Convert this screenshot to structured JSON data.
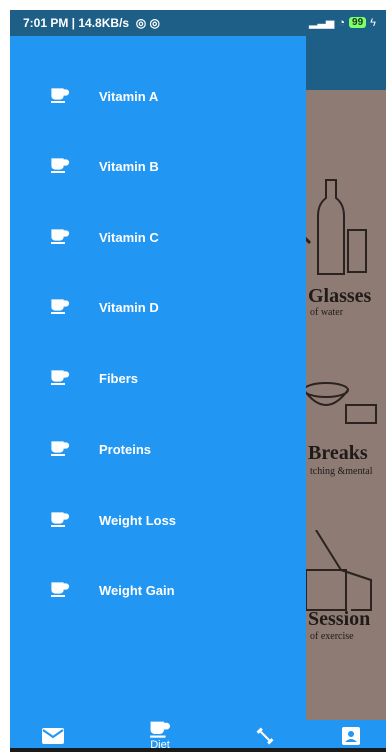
{
  "status_bar": {
    "time": "7:01 PM | 14.8KB/s",
    "battery": "99"
  },
  "drawer": {
    "items": [
      {
        "label": "Vitamin A",
        "icon": "coffee-cup-icon"
      },
      {
        "label": "Vitamin B",
        "icon": "coffee-cup-icon"
      },
      {
        "label": "Vitamin C",
        "icon": "coffee-cup-icon"
      },
      {
        "label": "Vitamin D",
        "icon": "coffee-cup-icon"
      },
      {
        "label": "Fibers",
        "icon": "coffee-cup-icon"
      },
      {
        "label": "Proteins",
        "icon": "coffee-cup-icon"
      },
      {
        "label": "Weight Loss",
        "icon": "coffee-cup-icon"
      },
      {
        "label": "Weight Gain",
        "icon": "coffee-cup-icon"
      }
    ]
  },
  "background_poster": {
    "lines": [
      {
        "word": "Glasses",
        "sub": "of water"
      },
      {
        "word": "Breaks",
        "sub": "tching &mental"
      },
      {
        "word": "Session",
        "sub": "of exercise"
      }
    ]
  },
  "bottom_nav": {
    "items": [
      {
        "icon": "mail-icon",
        "label": ""
      },
      {
        "icon": "coffee-cup-icon",
        "label": "Diet"
      },
      {
        "icon": "dumbbell-icon",
        "label": ""
      },
      {
        "icon": "account-box-icon",
        "label": ""
      }
    ]
  },
  "colors": {
    "drawer": "#2196f3",
    "app_bar": "#1e5f88",
    "poster_bg": "#8e7b73"
  }
}
